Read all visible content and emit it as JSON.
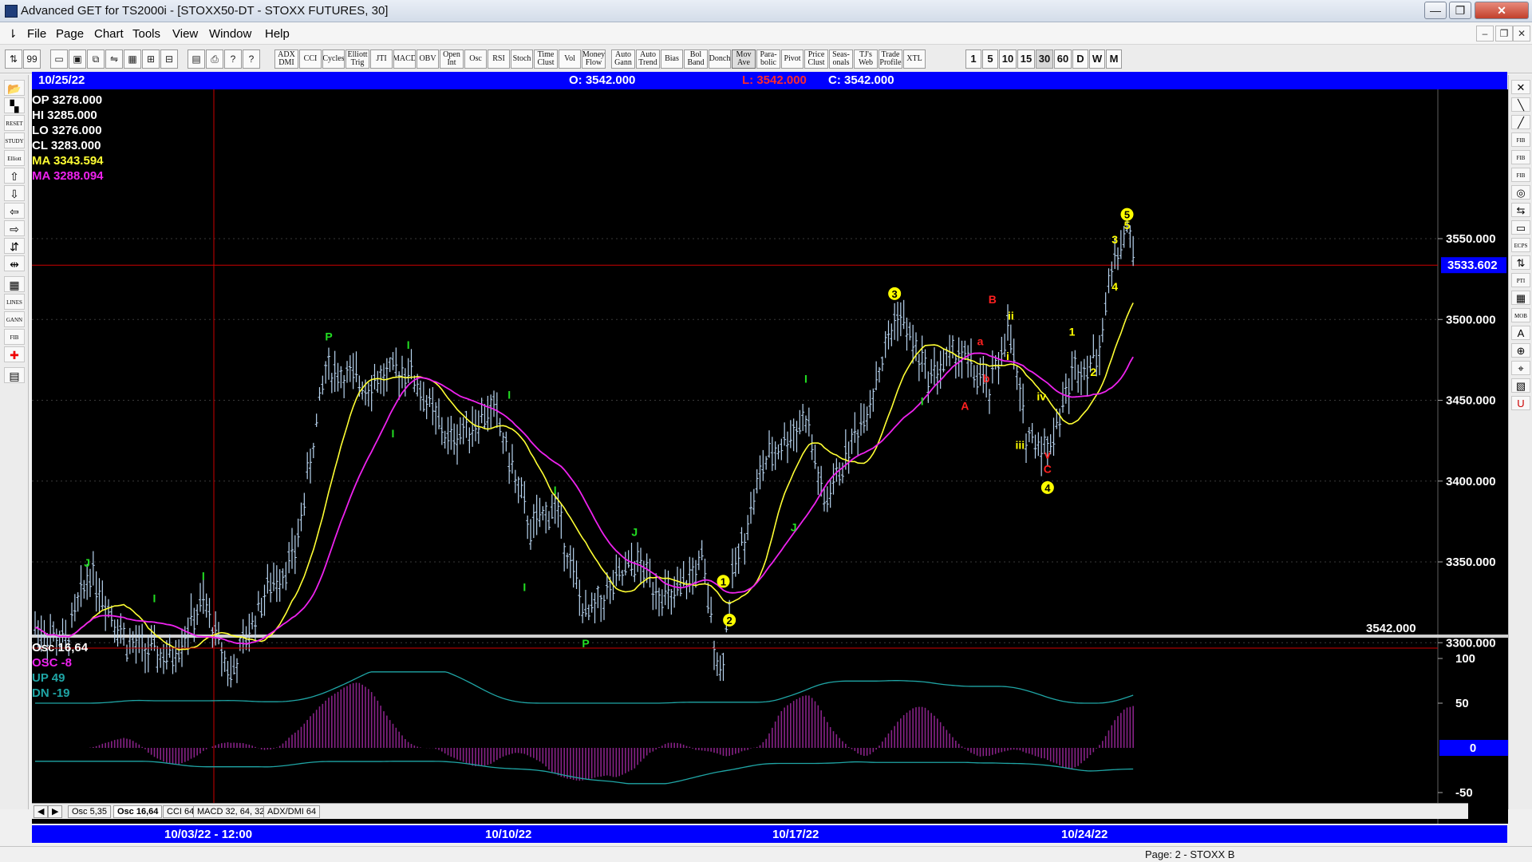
{
  "window": {
    "title": "Advanced GET for TS2000i - [STOXX50-DT - STOXX FUTURES, 30]",
    "minimize": "—",
    "maximize": "❐",
    "close": "✕"
  },
  "menu": {
    "items": [
      "File",
      "Page",
      "Chart",
      "Tools",
      "View",
      "Window",
      "Help"
    ],
    "mdi_buttons": [
      "–",
      "❐",
      "✕"
    ]
  },
  "toolbar": {
    "small_left": [
      "⇅",
      "99",
      "▭",
      "▣",
      "⧉",
      "⇋",
      "▦",
      "⊞",
      "⊟",
      "▤",
      "⎙",
      "?",
      "?"
    ],
    "studies": [
      "ADX DMI",
      "CCI",
      "Cycles",
      "Elliott Trig",
      "JTI",
      "MACD",
      "OBV",
      "Open Int",
      "Osc",
      "RSI",
      "Stoch",
      "Time Clust",
      "Vol",
      "Money Flow",
      "Auto Gann",
      "Auto Trend",
      "Bias",
      "Bol Band",
      "Donch",
      "Mov Ave",
      "Para- bolic",
      "Pivot",
      "Price Clust",
      "Seas- onals",
      "TJ's Web",
      "Trade Profile",
      "XTL"
    ],
    "timeframes": [
      "1",
      "5",
      "10",
      "15",
      "30",
      "60",
      "D",
      "W",
      "M"
    ],
    "selected_timeframe": "30"
  },
  "left_tools": [
    "📂",
    "▚",
    "RESET",
    "STUDY",
    "Elliott",
    "⇧",
    "⇩",
    "⇦",
    "⇨",
    "⇵",
    "⇹",
    "▦",
    "LINES",
    "GANN",
    "FIB",
    "✚",
    "▤"
  ],
  "right_tools": [
    "✕",
    "╲",
    "╱",
    "FIB RET",
    "FIB EXT",
    "FIB TIME",
    "◎",
    "⇆",
    "▭",
    "ECPS",
    "⇅",
    "PTI",
    "▦",
    "MOB",
    "A",
    "⊕",
    "⌖",
    "▧",
    "U"
  ],
  "header": {
    "date": "10/25/22",
    "open": "O: 3542.000",
    "low": "L: 3542.000",
    "close": "C: 3542.000"
  },
  "readout": {
    "op": "OP  3278.000",
    "hi": "HI   3285.000",
    "lo": "LO  3276.000",
    "cl": "CL  3283.000",
    "ma1": "MA  3343.594",
    "ma2": "MA  3288.094"
  },
  "price_axis": {
    "labels": [
      "3550.000",
      "3500.000",
      "3450.000",
      "3400.000",
      "3350.000",
      "3300.000"
    ],
    "values": [
      3550,
      3500,
      3450,
      3400,
      3350,
      3300
    ],
    "crosshair_value": "3533.602",
    "crosshair_price": 3533.602,
    "last_value": "3542.000"
  },
  "oscillator": {
    "title": "Osc 16,64",
    "osc": "OSC -8",
    "up": "UP   49",
    "dn": "DN   -19",
    "axis_labels": [
      "100",
      "50",
      "-50"
    ],
    "axis_values": [
      100,
      50,
      -50
    ],
    "zero_label": "0"
  },
  "bottom_tabs": [
    "Osc 5,35",
    "Osc 16,64",
    "CCI 64",
    "MACD 32, 64, 32",
    "ADX/DMI 64"
  ],
  "selected_tab": "Osc 16,64",
  "dates": {
    "labels": [
      "10/03/22 - 12:00",
      "10/10/22",
      "10/17/22",
      "10/24/22"
    ]
  },
  "status": {
    "page": "Page: 2 - STOXX B"
  },
  "colors": {
    "background": "#000000",
    "bar": "#b8d4f0",
    "ma_fast": "#ffff33",
    "ma_slow": "#ee22ee",
    "crosshair": "#cc0000",
    "wave_green": "#22dd22",
    "wave_yellow": "#ffff00",
    "wave_red": "#ff2020",
    "osc_hist": "#882288",
    "osc_up_dn": "#1fa5a5"
  },
  "wave_labels": [
    {
      "text": "J",
      "color": "green",
      "bar": 17,
      "price": 3343,
      "pos": "above"
    },
    {
      "text": "I",
      "color": "green",
      "bar": 39,
      "price": 3321,
      "pos": "above"
    },
    {
      "text": "I",
      "color": "green",
      "bar": 55,
      "price": 3335,
      "pos": "above"
    },
    {
      "text": "P",
      "color": "green",
      "bar": 96,
      "price": 3483,
      "pos": "above"
    },
    {
      "text": "I",
      "color": "green",
      "bar": 122,
      "price": 3478,
      "pos": "above"
    },
    {
      "text": "I",
      "color": "green",
      "bar": 117,
      "price": 3435,
      "pos": "below"
    },
    {
      "text": "I",
      "color": "green",
      "bar": 155,
      "price": 3447,
      "pos": "above"
    },
    {
      "text": "I",
      "color": "green",
      "bar": 170,
      "price": 3388,
      "pos": "above"
    },
    {
      "text": "I",
      "color": "green",
      "bar": 160,
      "price": 3340,
      "pos": "below"
    },
    {
      "text": "J",
      "color": "green",
      "bar": 196,
      "price": 3362,
      "pos": "above"
    },
    {
      "text": "P",
      "color": "green",
      "bar": 180,
      "price": 3305,
      "pos": "below"
    },
    {
      "text": "I",
      "color": "green",
      "bar": 252,
      "price": 3457,
      "pos": "above"
    },
    {
      "text": "J",
      "color": "green",
      "bar": 248,
      "price": 3377,
      "pos": "below"
    },
    {
      "text": "I",
      "color": "green",
      "bar": 290,
      "price": 3455,
      "pos": "below"
    },
    {
      "text": "1",
      "color": "yellow-circle",
      "bar": 225,
      "price": 3338,
      "pos": "at"
    },
    {
      "text": "2",
      "color": "yellow-circle",
      "bar": 227,
      "price": 3314,
      "pos": "at"
    },
    {
      "text": "3",
      "color": "yellow-circle",
      "bar": 281,
      "price": 3516,
      "pos": "at"
    },
    {
      "text": "B",
      "color": "red",
      "bar": 313,
      "price": 3510,
      "pos": "at"
    },
    {
      "text": "a",
      "color": "red",
      "bar": 309,
      "price": 3484,
      "pos": "at"
    },
    {
      "text": "b",
      "color": "red",
      "bar": 311,
      "price": 3461,
      "pos": "at"
    },
    {
      "text": "A",
      "color": "red",
      "bar": 304,
      "price": 3444,
      "pos": "at"
    },
    {
      "text": "ii",
      "color": "yellow",
      "bar": 319,
      "price": 3500,
      "pos": "at"
    },
    {
      "text": "i",
      "color": "yellow",
      "bar": 318,
      "price": 3475,
      "pos": "at"
    },
    {
      "text": "iv",
      "color": "yellow",
      "bar": 329,
      "price": 3450,
      "pos": "at"
    },
    {
      "text": "iii",
      "color": "yellow",
      "bar": 322,
      "price": 3420,
      "pos": "at"
    },
    {
      "text": "v",
      "color": "red",
      "bar": 331,
      "price": 3414,
      "pos": "at"
    },
    {
      "text": "C",
      "color": "red",
      "bar": 331,
      "price": 3405,
      "pos": "at"
    },
    {
      "text": "4",
      "color": "yellow-circle",
      "bar": 331,
      "price": 3396,
      "pos": "at"
    },
    {
      "text": "1",
      "color": "yellow",
      "bar": 339,
      "price": 3490,
      "pos": "at"
    },
    {
      "text": "2",
      "color": "yellow",
      "bar": 346,
      "price": 3465,
      "pos": "at"
    },
    {
      "text": "3",
      "color": "yellow",
      "bar": 353,
      "price": 3547,
      "pos": "at"
    },
    {
      "text": "4",
      "color": "yellow",
      "bar": 353,
      "price": 3518,
      "pos": "at"
    },
    {
      "text": "5",
      "color": "yellow",
      "bar": 357,
      "price": 3556,
      "pos": "at"
    },
    {
      "text": "5",
      "color": "yellow-circle",
      "bar": 357,
      "price": 3565,
      "pos": "at"
    }
  ]
}
